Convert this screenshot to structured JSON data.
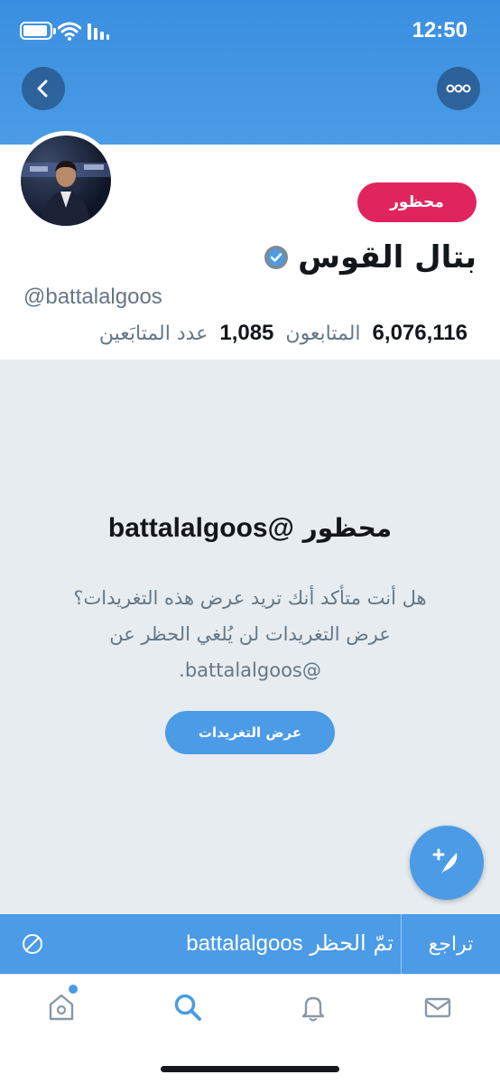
{
  "status_bar": {
    "time": "12:50"
  },
  "profile": {
    "name": "بتال القوس",
    "handle": "@battalalgoos",
    "blocked_label": "محظور",
    "followers_count": "6,076,116",
    "followers_label": "المتابعون",
    "following_count": "1,085",
    "following_label": "عدد المتابَعين"
  },
  "blocked_notice": {
    "title_word": "محظور",
    "title_handle": "@battalalgoos",
    "description": "هل أنت متأكد أنك تريد عرض هذه التغريدات؟ عرض التغريدات لن يُلغي الحظر عن @battalalgoos.",
    "view_button": "عرض التغريدات"
  },
  "toast": {
    "message": "تمّ الحظر",
    "username": "battalalgoos",
    "undo_label": "تراجع"
  },
  "icons": {
    "back": "chevron-left-icon",
    "more": "more-icon",
    "verified": "verified-icon",
    "compose": "compose-icon",
    "blocked": "block-icon",
    "home": "home-icon",
    "search": "search-icon",
    "notifications": "bell-icon",
    "messages": "mail-icon"
  },
  "colors": {
    "accent": "#4b9be6",
    "blocked": "#e0245e",
    "muted_text": "#657786",
    "background_grey": "#e6ecf0"
  }
}
